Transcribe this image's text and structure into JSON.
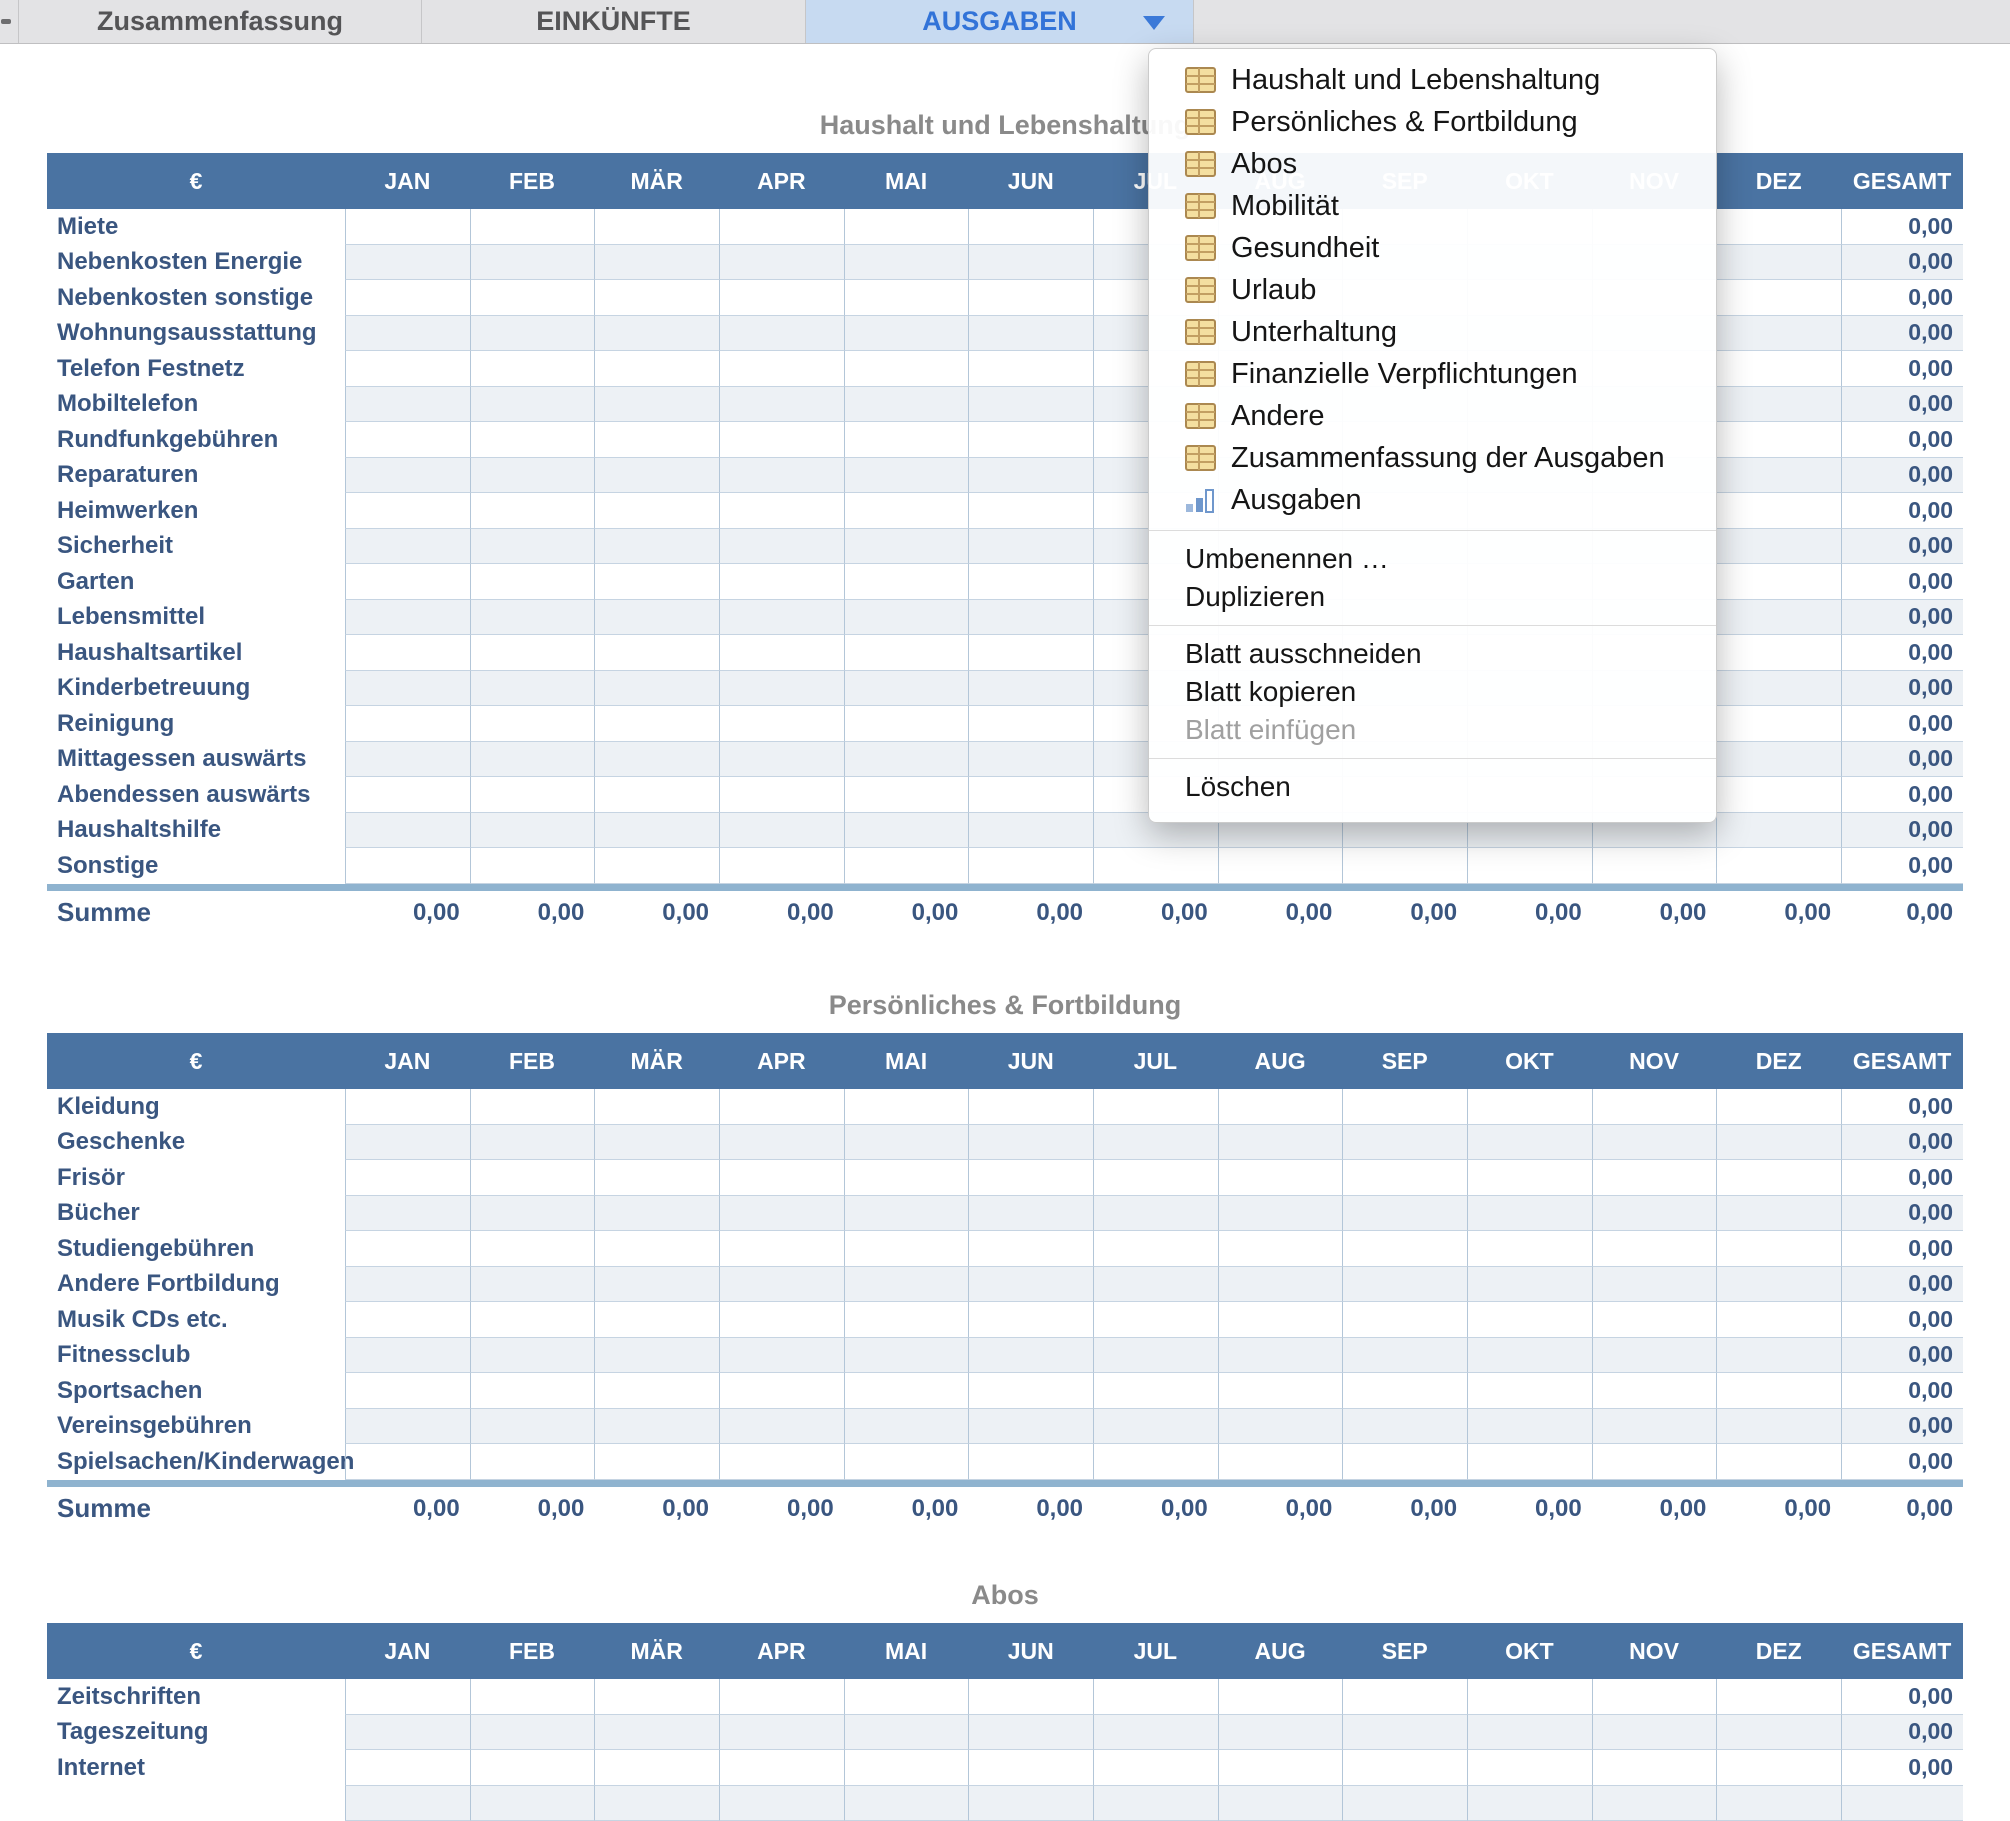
{
  "tab_bar": {
    "tabs": [
      {
        "label": "Zusammenfassung",
        "active": false
      },
      {
        "label": "EINKÜNFTE",
        "active": false
      },
      {
        "label": "AUSGABEN",
        "active": true
      }
    ]
  },
  "menu": {
    "sheet_items": [
      "Haushalt und Lebenshaltung",
      "Persönliches & Fortbildung",
      "Abos",
      "Mobilität",
      "Gesundheit",
      "Urlaub",
      "Unterhaltung",
      "Finanzielle Verpflichtungen",
      "Andere",
      "Zusammenfassung der Ausgaben"
    ],
    "chart_item": "Ausgaben",
    "action_groups": [
      [
        {
          "label": "Umbenennen …",
          "disabled": false
        },
        {
          "label": "Duplizieren",
          "disabled": false
        }
      ],
      [
        {
          "label": "Blatt ausschneiden",
          "disabled": false
        },
        {
          "label": "Blatt kopieren",
          "disabled": false
        },
        {
          "label": "Blatt einfügen",
          "disabled": true
        }
      ],
      [
        {
          "label": "Löschen",
          "disabled": false
        }
      ]
    ]
  },
  "months": [
    "JAN",
    "FEB",
    "MÄR",
    "APR",
    "MAI",
    "JUN",
    "JUL",
    "AUG",
    "SEP",
    "OKT",
    "NOV",
    "DEZ"
  ],
  "currency_header": "€",
  "gesamt_header": "GESAMT",
  "summe_label": "Summe",
  "zero_value": "0,00",
  "tables": [
    {
      "title": "Haushalt und Lebenshaltung",
      "rows": [
        "Miete",
        "Nebenkosten Energie",
        "Nebenkosten sonstige",
        "Wohnungsausstattung",
        "Telefon Festnetz",
        "Mobiltelefon",
        "Rundfunkgebühren",
        "Reparaturen",
        "Heimwerken",
        "Sicherheit",
        "Garten",
        "Lebensmittel",
        "Haushaltsartikel",
        "Kinderbetreuung",
        "Reinigung",
        "Mittagessen auswärts",
        "Abendessen auswärts",
        "Haushaltshilfe",
        "Sonstige"
      ],
      "has_partial_row": false
    },
    {
      "title": "Persönliches & Fortbildung",
      "rows": [
        "Kleidung",
        "Geschenke",
        "Frisör",
        "Bücher",
        "Studiengebühren",
        "Andere Fortbildung",
        "Musik CDs etc.",
        "Fitnessclub",
        "Sportsachen",
        "Vereinsgebühren",
        "Spielsachen/Kinderwagen"
      ],
      "has_partial_row": false
    },
    {
      "title": "Abos",
      "rows": [
        "Zeitschriften",
        "Tageszeitung",
        "Internet"
      ],
      "has_partial_row": true
    }
  ]
}
